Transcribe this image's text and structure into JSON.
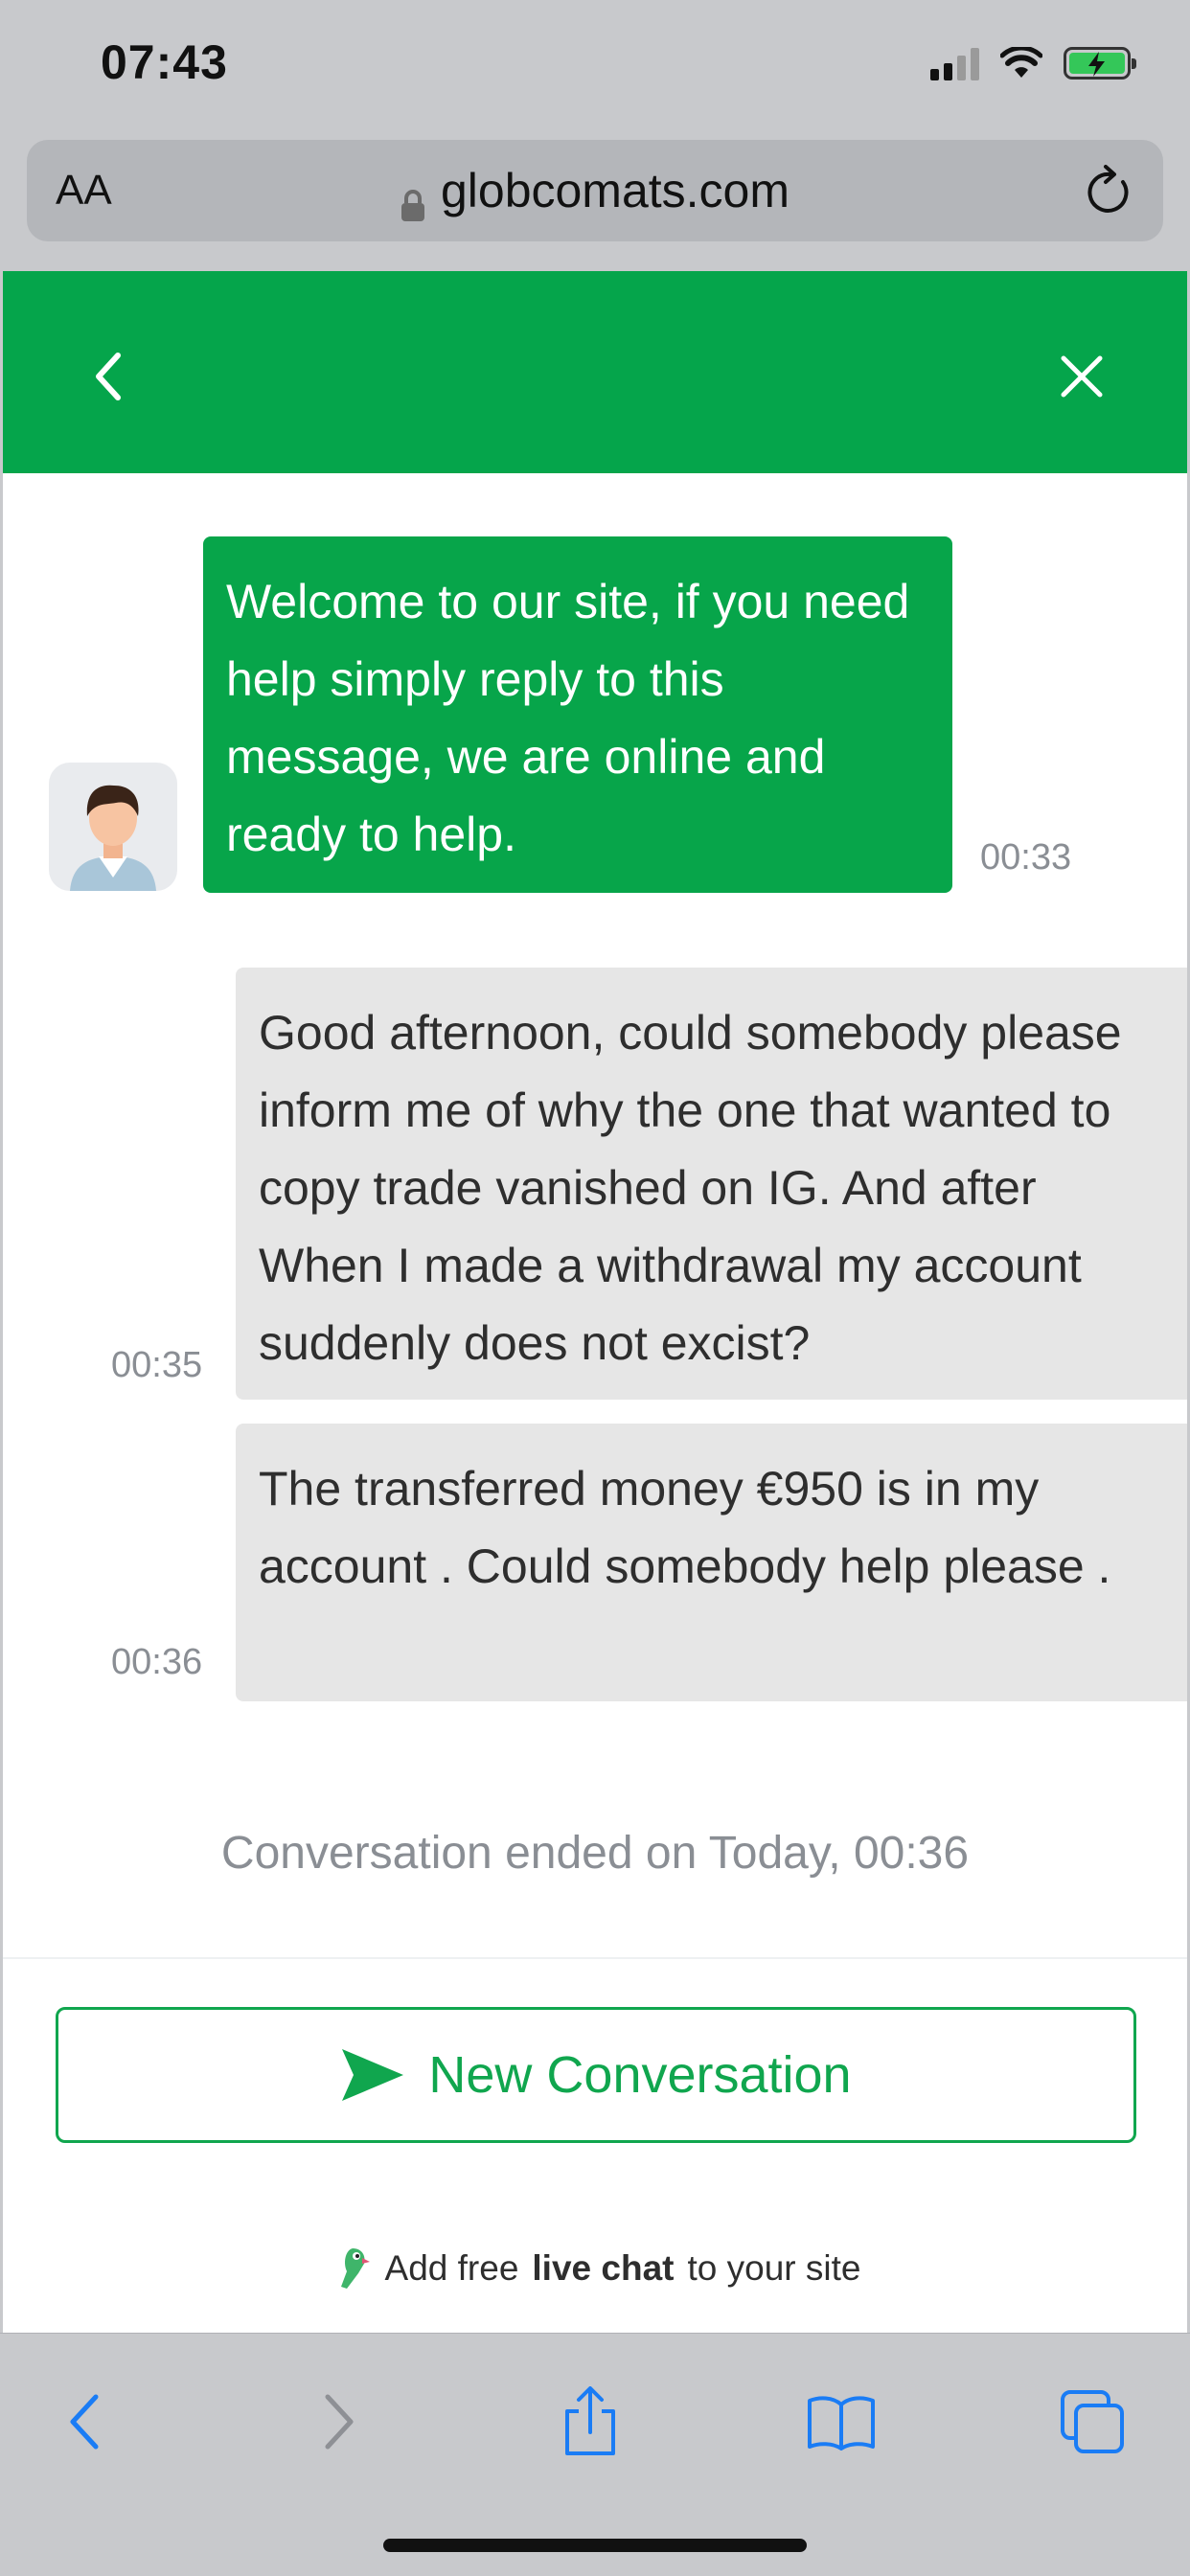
{
  "status_bar": {
    "time": "07:43"
  },
  "browser": {
    "text_size_label": "AA",
    "url": "globcomats.com"
  },
  "chat": {
    "messages": [
      {
        "from": "agent",
        "text": "Welcome to our site, if you need help simply reply to this message, we are online and ready to help.",
        "time": "00:33"
      },
      {
        "from": "user",
        "text": "Good afternoon, could somebody please inform me of why the one that wanted to copy trade vanished on IG. And after When I made a withdrawal my account suddenly does not excist?",
        "time": "00:35"
      },
      {
        "from": "user",
        "text": "The transferred money €950 is in my account . Could somebody help please .",
        "time": "00:36"
      }
    ],
    "ended_text": "Conversation ended on Today, 00:36",
    "new_conversation_label": "New Conversation",
    "footer": {
      "prefix": "Add free",
      "bold": "live chat",
      "suffix": "to your site"
    }
  },
  "colors": {
    "brand_green": "#05a54b",
    "user_bubble": "#e6e6e6",
    "ios_blue": "#1a7cf5"
  }
}
